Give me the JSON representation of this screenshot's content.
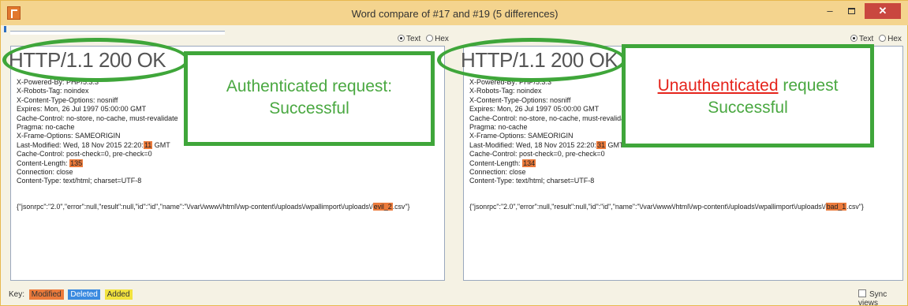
{
  "window": {
    "title": "Word compare of #17 and #19  (5 differences)",
    "minimize": "–",
    "close": "✕"
  },
  "left": {
    "mode_text": "Text",
    "mode_hex": "Hex",
    "selected_mode": "Text",
    "status_line": "HTTP/1.1 200 OK",
    "headers": [
      "X-Powered-By: PHP/5.3.3",
      "X-Robots-Tag: noindex",
      "X-Content-Type-Options: nosniff",
      "Expires: Mon, 26 Jul 1997 05:00:00 GMT",
      "Cache-Control: no-store, no-cache, must-revalidate",
      "Pragma: no-cache",
      "X-Frame-Options: SAMEORIGIN"
    ],
    "last_modified_prefix": "Last-Modified: Wed, 18 Nov 2015 22:20:",
    "last_modified_diff": "11",
    "last_modified_suffix": " GMT",
    "cache_control2": "Cache-Control: post-check=0, pre-check=0",
    "content_length_prefix": "Content-Length: ",
    "content_length_diff": "135",
    "connection": "Connection: close",
    "content_type": "Content-Type: text/html; charset=UTF-8",
    "json_prefix": "{\"jsonrpc\":\"2.0\",\"error\":null,\"result\":null,\"id\":\"id\",\"name\":\"\\/var\\/www\\/html\\/wp-content\\/uploads\\/wpallimport\\/uploads\\/",
    "json_diff": "evil_2",
    "json_suffix": ".csv\"}",
    "callout_line1": "Authenticated request:",
    "callout_line2": "Successful"
  },
  "right": {
    "mode_text": "Text",
    "mode_hex": "Hex",
    "selected_mode": "Text",
    "status_line": "HTTP/1.1 200 OK",
    "headers": [
      "X-Powered-By: PHP/5.3.3",
      "X-Robots-Tag: noindex",
      "X-Content-Type-Options: nosniff",
      "Expires: Mon, 26 Jul 1997 05:00:00 GMT",
      "Cache-Control: no-store, no-cache, must-revalidate",
      "Pragma: no-cache",
      "X-Frame-Options: SAMEORIGIN"
    ],
    "last_modified_prefix": "Last-Modified: Wed, 18 Nov 2015 22:20:",
    "last_modified_diff": "31",
    "last_modified_suffix": " GMT",
    "cache_control2": "Cache-Control: post-check=0, pre-check=0",
    "content_length_prefix": "Content-Length: ",
    "content_length_diff": "134",
    "connection": "Connection: close",
    "content_type": "Content-Type: text/html; charset=UTF-8",
    "json_prefix": "{\"jsonrpc\":\"2.0\",\"error\":null,\"result\":null,\"id\":\"id\",\"name\":\"\\/var\\/www\\/html\\/wp-content\\/uploads\\/wpallimport\\/uploads\\/",
    "json_diff": "bad_1",
    "json_suffix": ".csv\"}",
    "callout_red": "Unauthenticated",
    "callout_line1_rest": " request",
    "callout_line2": "Successful"
  },
  "footer": {
    "key_label": "Key:",
    "modified": "Modified",
    "deleted": "Deleted",
    "added": "Added",
    "sync_views": "Sync views"
  },
  "colors": {
    "modified": "#ec7b3c",
    "deleted": "#3a8ae0",
    "added": "#f2e33e",
    "annotation_green": "#3fa63a",
    "annotation_red": "#e5241c"
  }
}
